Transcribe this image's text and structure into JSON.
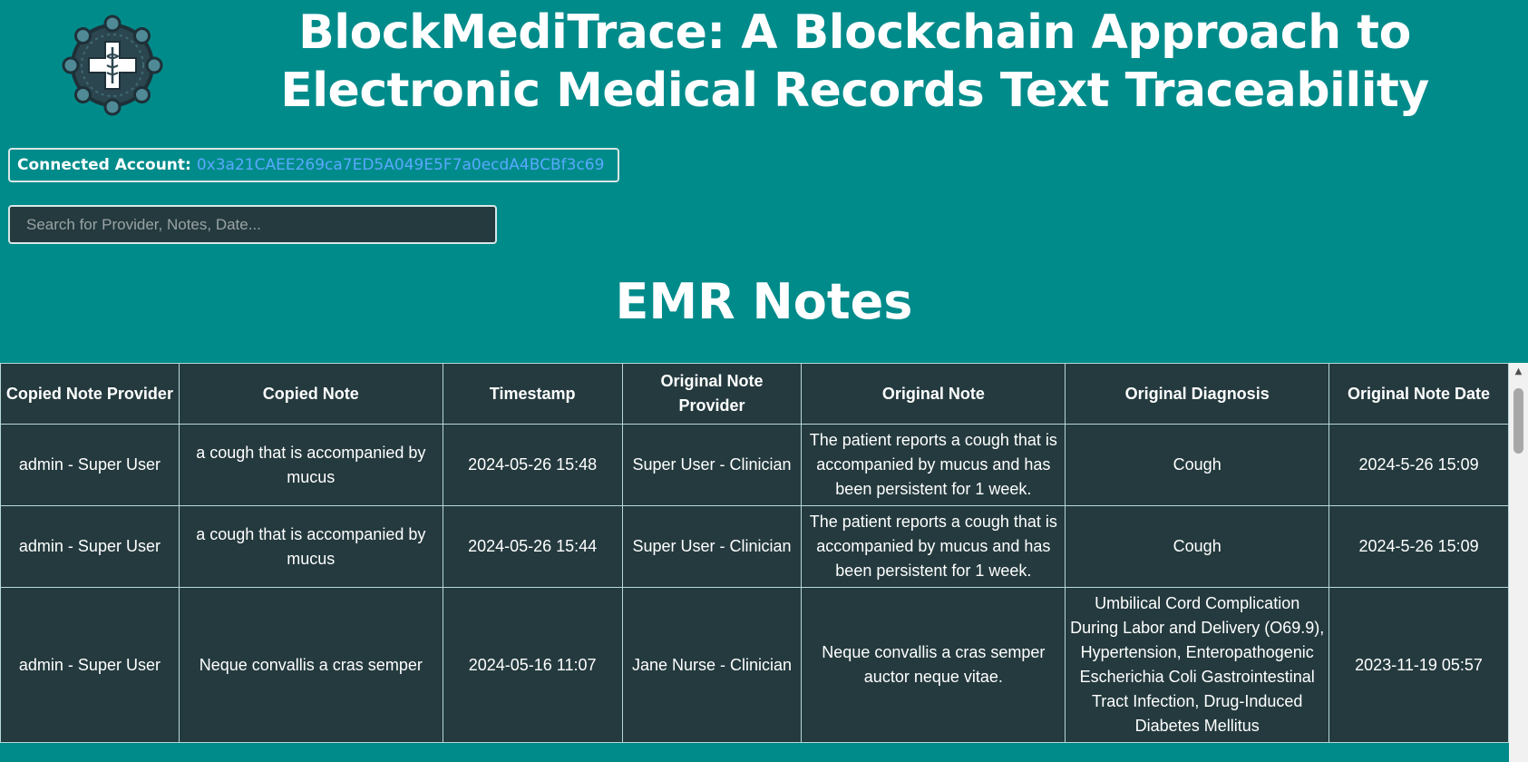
{
  "header": {
    "title_line1": "BlockMediTrace: A Blockchain Approach to",
    "title_line2": "Electronic Medical Records Text Traceability"
  },
  "account": {
    "label": "Connected Account:",
    "address": "0x3a21CAEE269ca7ED5A049E5F7a0ecdA4BCBf3c69"
  },
  "search": {
    "placeholder": "Search for Provider, Notes, Date..."
  },
  "section_title": "EMR Notes",
  "table": {
    "headers": [
      "Copied Note Provider",
      "Copied Note",
      "Timestamp",
      "Original Note Provider",
      "Original Note",
      "Original Diagnosis",
      "Original Note Date"
    ],
    "rows": [
      [
        "admin - Super User",
        "a cough that is accompanied by mucus",
        "2024-05-26 15:48",
        "Super User - Clinician",
        "The patient reports a cough that is accompanied by mucus and has been persistent for 1 week.",
        "Cough",
        "2024-5-26 15:09"
      ],
      [
        "admin - Super User",
        "a cough that is accompanied by mucus",
        "2024-05-26 15:44",
        "Super User - Clinician",
        "The patient reports a cough that is accompanied by mucus and has been persistent for 1 week.",
        "Cough",
        "2024-5-26 15:09"
      ],
      [
        "admin - Super User",
        "Neque convallis a cras semper",
        "2024-05-16 11:07",
        "Jane Nurse - Clinician",
        "Neque convallis a cras semper auctor neque vitae.",
        "Umbilical Cord Complication During Labor and Delivery (O69.9), Hypertension, Enteropathogenic Escherichia Coli Gastrointestinal Tract Infection, Drug-Induced Diabetes Mellitus",
        "2023-11-19 05:57"
      ]
    ]
  },
  "icons": {
    "logo": "medical-blockchain-logo-icon",
    "scroll_up": "chevron-up-icon"
  },
  "colors": {
    "background": "#008b8b",
    "table_bg": "#243a3e",
    "address_link": "#5aa9ff",
    "border": "#b8d8d8"
  }
}
